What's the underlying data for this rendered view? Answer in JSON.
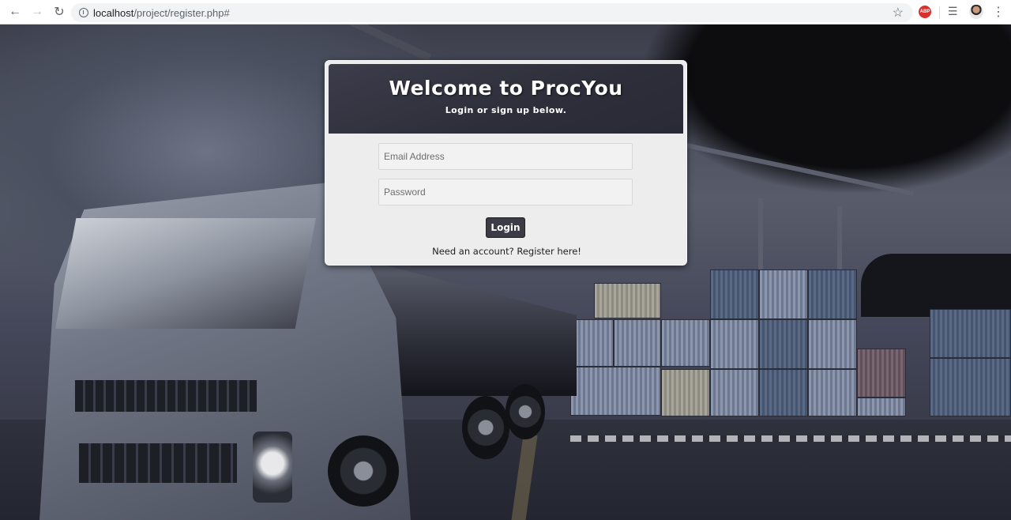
{
  "browser": {
    "url_host": "localhost",
    "url_path": "/project/register.php#",
    "abp_label": "ABP"
  },
  "login": {
    "title": "Welcome to ProcYou",
    "subtitle": "Login or sign up below.",
    "email_placeholder": "Email Address",
    "password_placeholder": "Password",
    "login_label": "Login",
    "register_prompt": "Need an account?",
    "register_link": "Register here!"
  }
}
